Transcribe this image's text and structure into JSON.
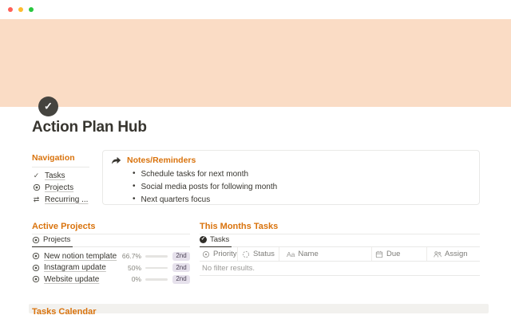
{
  "window": {
    "buttons": {
      "close": "close",
      "minimize": "minimize",
      "zoom": "zoom"
    }
  },
  "page": {
    "title": "Action Plan Hub",
    "icon": "check-circle-icon",
    "banner_color": "#FADCC5",
    "accent_color": "#D9730D"
  },
  "navigation": {
    "header": "Navigation",
    "items": [
      {
        "icon": "check-icon",
        "label": "Tasks"
      },
      {
        "icon": "target-icon",
        "label": "Projects"
      },
      {
        "icon": "repeat-icon",
        "label": "Recurring ..."
      }
    ]
  },
  "notes": {
    "icon": "forward-arrow-icon",
    "header": "Notes/Reminders",
    "bullets": [
      "Schedule tasks for next month",
      "Social media posts for following month",
      "Next quarters focus"
    ]
  },
  "active_projects": {
    "header": "Active Projects",
    "tab": {
      "icon": "target-icon",
      "label": "Projects"
    },
    "rows": [
      {
        "icon": "target-icon",
        "name": "New notion template",
        "percent": "66.7%",
        "progress": 66.7,
        "badge": "2nd"
      },
      {
        "icon": "target-icon",
        "name": "Instagram update",
        "percent": "50%",
        "progress": 50,
        "badge": "2nd"
      },
      {
        "icon": "target-icon",
        "name": "Website update",
        "percent": "0%",
        "progress": 0,
        "badge": "2nd"
      }
    ],
    "progress_color": "#448361",
    "badge_bg": "#E6E1EC"
  },
  "month_tasks": {
    "header": "This Months Tasks",
    "tab": {
      "icon": "check-circle-icon",
      "label": "Tasks"
    },
    "columns": [
      {
        "icon": "priority-circle-icon",
        "label": "Priority"
      },
      {
        "icon": "status-dashed-circle-icon",
        "label": "Status"
      },
      {
        "icon": "text-aa-icon",
        "label": "Name"
      },
      {
        "icon": "calendar-icon",
        "label": "Due"
      },
      {
        "icon": "people-icon",
        "label": "Assign"
      }
    ],
    "empty": "No filter results."
  },
  "calendar": {
    "header": "Tasks Calendar"
  }
}
